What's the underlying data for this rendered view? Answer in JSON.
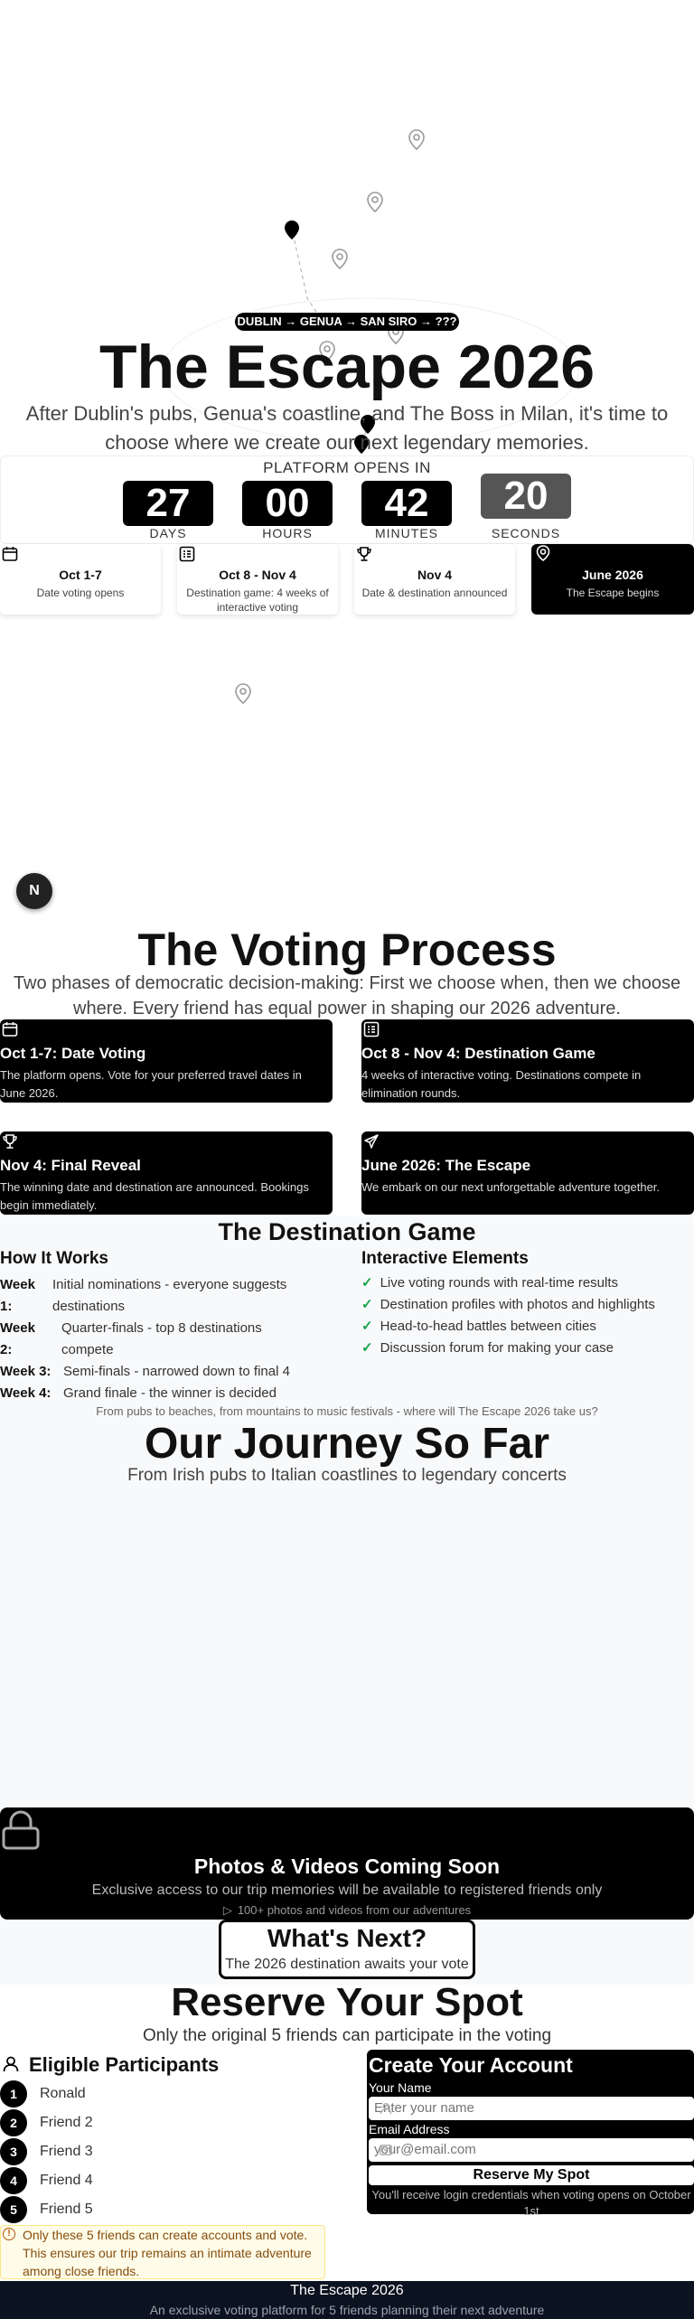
{
  "hero": {
    "route_badge": "DUBLIN → GENUA → SAN SIRO → ???",
    "title": "The Escape 2026",
    "subtitle": "After Dublin's pubs, Genua's coastline, and The Boss in Milan, it's time to choose where we create our next legendary memories."
  },
  "countdown": {
    "heading": "PLATFORM OPENS IN",
    "units": [
      {
        "value": "27",
        "label": "DAYS"
      },
      {
        "value": "00",
        "label": "HOURS"
      },
      {
        "value": "42",
        "label": "MINUTES"
      },
      {
        "value": "20",
        "label": "SECONDS"
      }
    ]
  },
  "timeline": [
    {
      "icon": "calendar-icon",
      "title": "Oct 1-7",
      "desc": "Date voting opens"
    },
    {
      "icon": "checklist-icon",
      "title": "Oct 8 - Nov 4",
      "desc": "Destination game: 4 weeks of interactive voting"
    },
    {
      "icon": "trophy-icon",
      "title": "Nov 4",
      "desc": "Date & destination announced"
    },
    {
      "icon": "map-pin-icon",
      "title": "June 2026",
      "desc": "The Escape begins"
    }
  ],
  "avatar": {
    "letter": "N"
  },
  "voting": {
    "title": "The Voting Process",
    "subtitle": "Two phases of democratic decision-making: First we choose when, then we choose where. Every friend has equal power in shaping our 2026 adventure.",
    "cards": [
      {
        "icon": "calendar-icon",
        "title": "Oct 1-7: Date Voting",
        "desc": "The platform opens. Vote for your preferred travel dates in June 2026."
      },
      {
        "icon": "checklist-icon",
        "title": "Oct 8 - Nov 4: Destination Game",
        "desc": "4 weeks of interactive voting. Destinations compete in elimination rounds."
      },
      {
        "icon": "trophy-icon",
        "title": "Nov 4: Final Reveal",
        "desc": "The winning date and destination are announced. Bookings begin immediately."
      },
      {
        "icon": "plane-icon",
        "title": "June 2026: The Escape",
        "desc": "We embark on our next unforgettable adventure together."
      }
    ]
  },
  "game": {
    "title": "The Destination Game",
    "how_title": "How It Works",
    "weeks": [
      {
        "label": "Week 1:",
        "text": "Initial nominations - everyone suggests destinations"
      },
      {
        "label": "Week 2:",
        "text": "Quarter-finals - top 8 destinations compete"
      },
      {
        "label": "Week 3:",
        "text": "Semi-finals - narrowed down to final 4"
      },
      {
        "label": "Week 4:",
        "text": "Grand finale - the winner is decided"
      }
    ],
    "elements_title": "Interactive Elements",
    "elements": [
      "Live voting rounds with real-time results",
      "Destination profiles with photos and highlights",
      "Head-to-head battles between cities",
      "Discussion forum for making your case"
    ],
    "footnote": "From pubs to beaches, from mountains to music festivals - where will The Escape 2026 take us?"
  },
  "journey": {
    "title": "Our Journey So Far",
    "subtitle": "From Irish pubs to Italian coastlines to legendary concerts"
  },
  "coming_soon": {
    "title": "Photos & Videos Coming Soon",
    "desc": "Exclusive access to our trip memories will be available to registered friends only",
    "meta": "100+ photos and videos from our adventures"
  },
  "whats_next": {
    "title": "What's Next?",
    "subtitle": "The 2026 destination awaits your vote"
  },
  "reserve": {
    "title": "Reserve Your Spot",
    "subtitle": "Only the original 5 friends can participate in the voting"
  },
  "participants": {
    "title": "Eligible Participants",
    "list": [
      {
        "num": "1",
        "name": "Ronald"
      },
      {
        "num": "2",
        "name": "Friend 2"
      },
      {
        "num": "3",
        "name": "Friend 3"
      },
      {
        "num": "4",
        "name": "Friend 4"
      },
      {
        "num": "5",
        "name": "Friend 5"
      }
    ],
    "notice": "Only these 5 friends can create accounts and vote. This ensures our trip remains an intimate adventure among close friends."
  },
  "account": {
    "title": "Create Your Account",
    "name_label": "Your Name",
    "name_placeholder": "Enter your name",
    "email_label": "Email Address",
    "email_placeholder": "your@email.com",
    "button": "Reserve My Spot",
    "note": "You'll receive login credentials when voting opens on October 1st"
  },
  "footer": {
    "title": "The Escape 2026",
    "subtitle": "An exclusive voting platform for 5 friends planning their next adventure"
  },
  "colors": {
    "accent": "#000000",
    "check": "#16a34a",
    "notice_bg": "#fefce8",
    "notice_text": "#854d0e",
    "page_gray": "#f8f9fb"
  }
}
